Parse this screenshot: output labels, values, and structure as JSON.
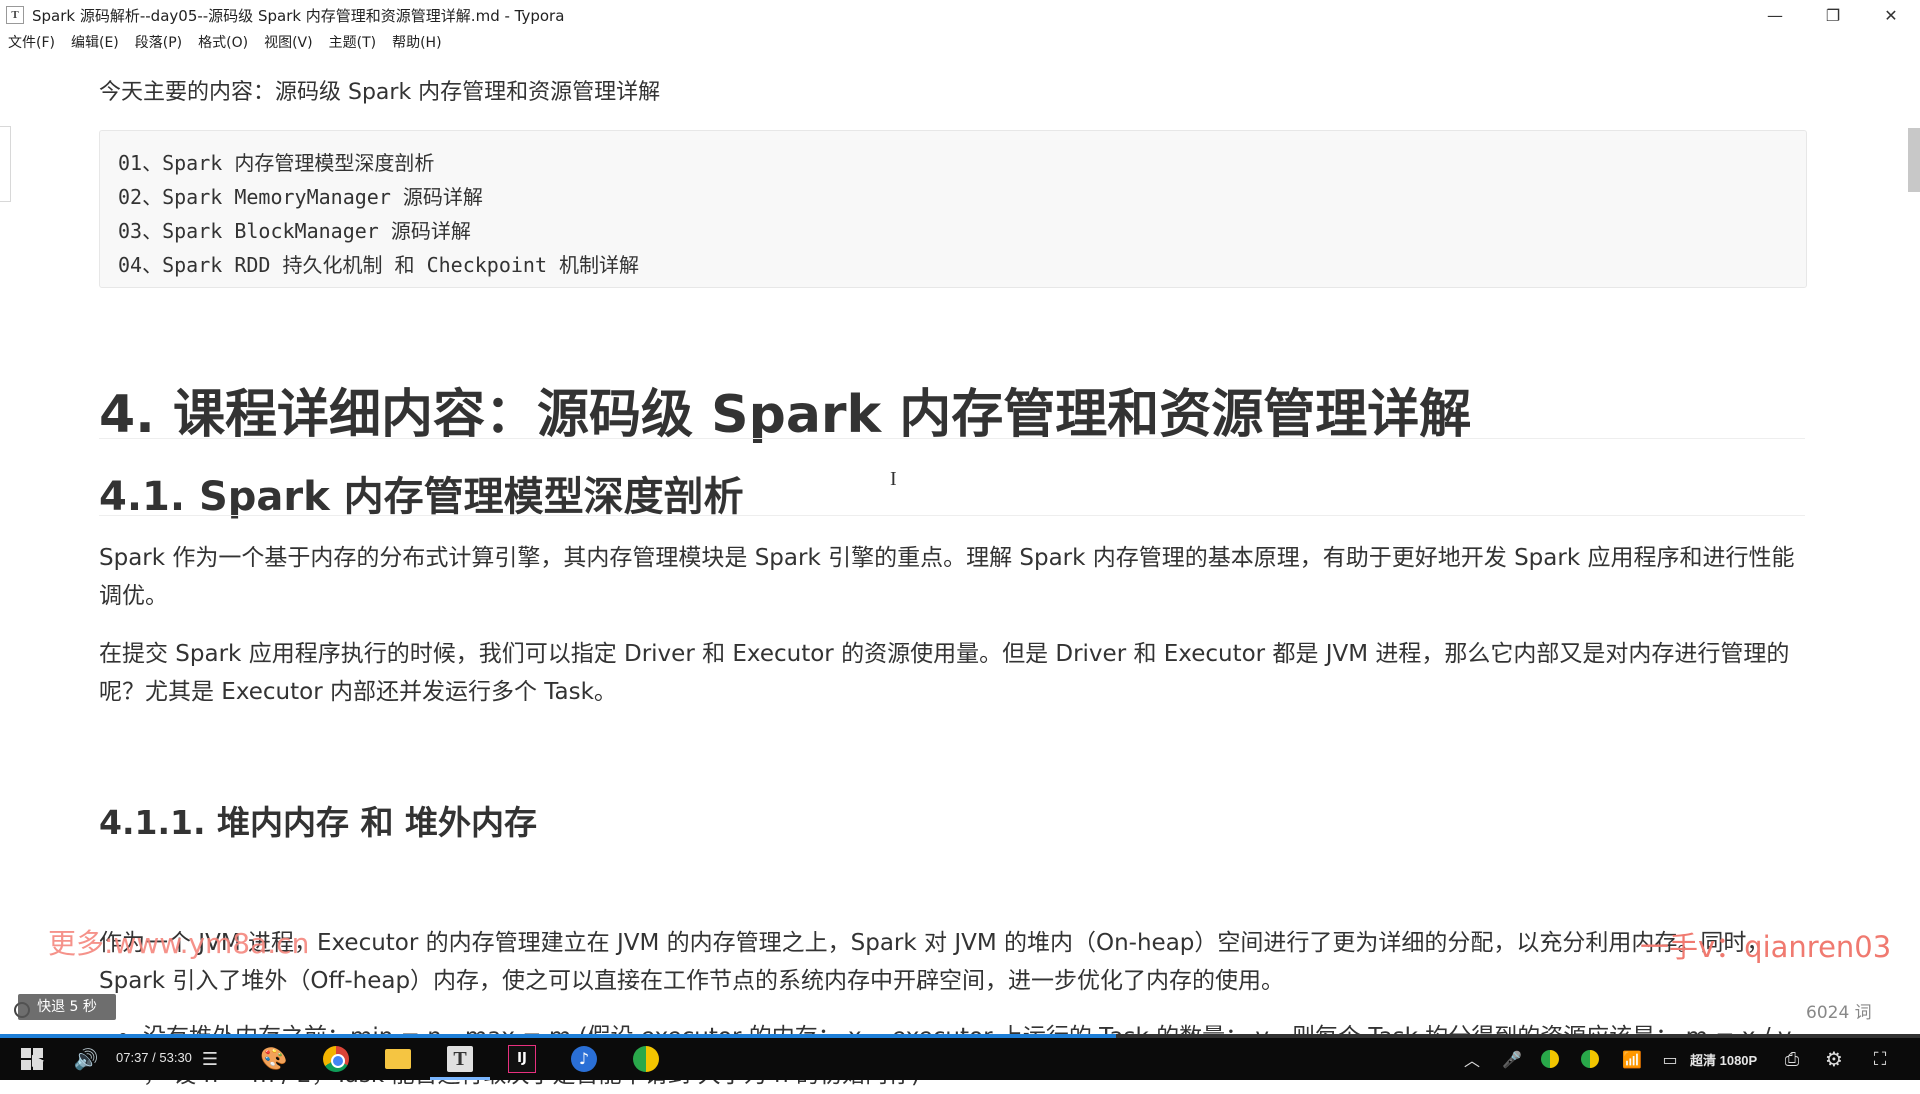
{
  "window": {
    "icon_letter": "T",
    "title": "Spark 源码解析--day05--源码级 Spark 内存管理和资源管理详解.md - Typora",
    "minimize": "—",
    "maximize": "❐",
    "close": "✕"
  },
  "menu": [
    "文件(F)",
    "编辑(E)",
    "段落(P)",
    "格式(O)",
    "视图(V)",
    "主题(T)",
    "帮助(H)"
  ],
  "document": {
    "intro": "今天主要的内容：源码级 Spark 内存管理和资源管理详解",
    "code_lines": [
      "01、Spark 内存管理模型深度剖析",
      "02、Spark MemoryManager 源码详解",
      "03、Spark BlockManager 源码详解",
      "04、Spark RDD 持久化机制 和 Checkpoint 机制详解"
    ],
    "h1": "4. 课程详细内容：源码级 Spark 内存管理和资源管理详解",
    "h2": "4.1. Spark 内存管理模型深度剖析",
    "p1": "Spark 作为一个基于内存的分布式计算引擎，其内存管理模块是 Spark 引擎的重点。理解 Spark 内存管理的基本原理，有助于更好地开发 Spark 应用程序和进行性能调优。",
    "p2": "在提交 Spark 应用程序执行的时候，我们可以指定 Driver 和 Executor 的资源使用量。但是 Driver 和 Executor 都是 JVM 进程，那么它内部又是对内存进行管理的呢？尤其是 Executor 内部还并发运行多个 Task。",
    "h3": "4.1.1. 堆内内存 和 堆外内存",
    "p3": "作为一个 JVM 进程，Executor 的内存管理建立在 JVM 的内存管理之上，Spark 对 JVM 的堆内（On-heap）空间进行了更为详细的分配，以充分利用内存。同时，Spark 引入了堆外（Off-heap）内存，使之可以直接在工作节点的系统内存中开辟空间，进一步优化了内存的使用。",
    "bullet1": "没有堆外内存之前：min = n，max = m (假设 executor 的内存： x， executor 上运行的 Task 的数量： y，则每个 Task 均分得到的资源应该是： m = x / y ， 设 n = m / 2，Task 能否运行取决于是否能申请到 大小为 n 的初始内存)",
    "word_count": "6024 词"
  },
  "overlay": {
    "watermark_left": "更多:www.ym8a.cn",
    "watermark_right": "一手v：qianren03",
    "rewind": "快退 5 秒"
  },
  "player": {
    "time": "07:37 / 53:30",
    "quality": "超清 1080P",
    "progress": 0.581
  },
  "colors": {
    "watermark": "#f07a70",
    "progress": "#1e7fd8",
    "taskbar": "#0b0b0b"
  }
}
